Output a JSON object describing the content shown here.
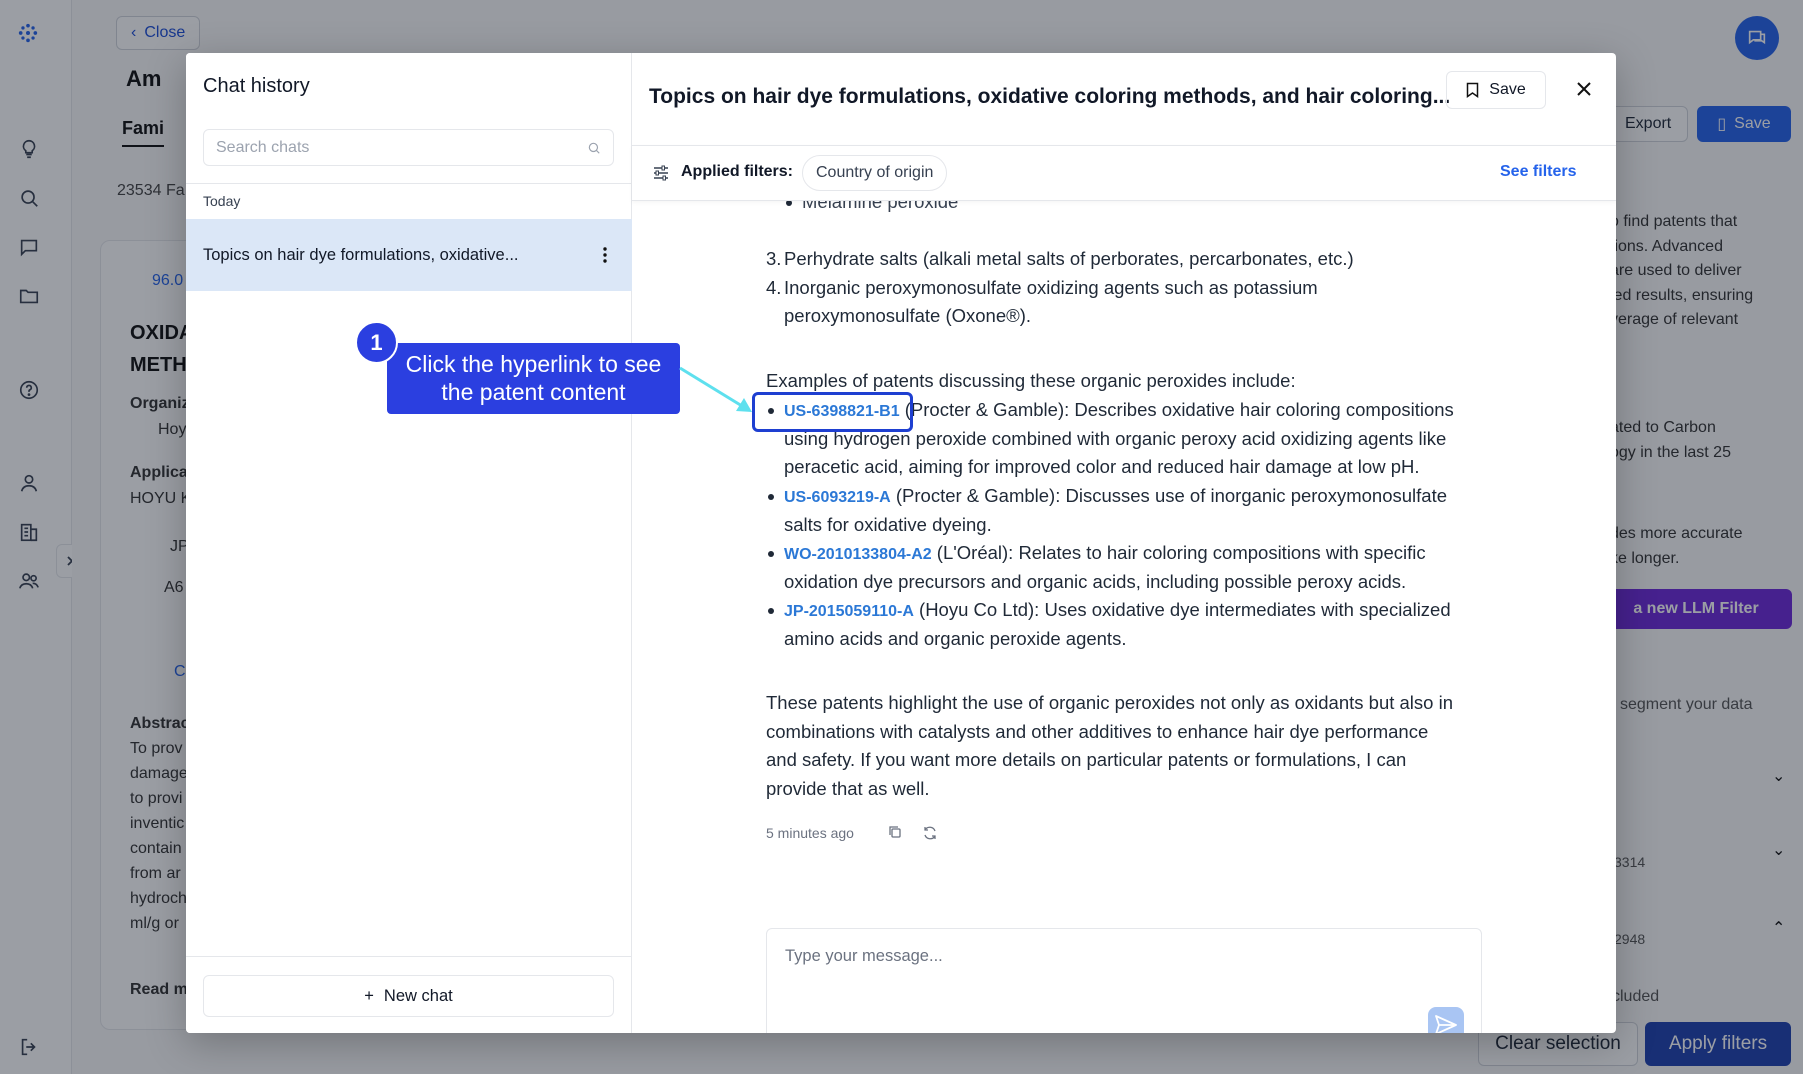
{
  "background": {
    "close_label": "Close",
    "title": "Am",
    "tab": "Fami",
    "count": "23534 Fa",
    "score": "96.0",
    "heading1": "OXIDA",
    "heading2": "METH",
    "org_label": "Organiz",
    "org_value": "Hoy",
    "applicant_label": "Applica",
    "applicant_value": "HOYU K",
    "jp": "JP",
    "a6": "A6",
    "doc_link": "C",
    "abstract_label": "Abstrac",
    "abstract_lines": [
      "To prov",
      "damage",
      "to provi",
      "inventic",
      "contain",
      "from ar",
      "hydroch",
      "ml/g or"
    ],
    "read_more": "Read m",
    "export_label": "Export",
    "save_label": "Save",
    "right_text_1": [
      "o find patents that",
      "tions. Advanced",
      "are used to deliver",
      "led results, ensuring",
      "verage of relevant"
    ],
    "right_text_2": [
      "ated to Carbon",
      "ogy in the last 25"
    ],
    "right_text_3": [
      "des more accurate",
      "ke longer."
    ],
    "llm_button": "a new LLM Filter",
    "segment_text": "segment your data",
    "num_3314": "3314",
    "num_2948": "2948",
    "cluded": "cluded",
    "clear_selection": "Clear selection",
    "apply_filters": "Apply filters"
  },
  "history": {
    "title": "Chat history",
    "search_placeholder": "Search chats",
    "group": "Today",
    "items": [
      {
        "label": "Topics on hair dye formulations, oxidative..."
      }
    ],
    "new_chat": "New chat"
  },
  "chat": {
    "title": "Topics on hair dye formulations, oxidative coloring methods, and hair coloring...",
    "save_label": "Save",
    "filters_label": "Applied filters:",
    "filter_chips": [
      "Country of origin"
    ],
    "see_filters": "See filters",
    "cut_item": "Melamine peroxide",
    "list_3_num": "3.",
    "list_3": "Perhydrate salts (alkali metal salts of perborates, percarbonates, etc.)",
    "list_4_num": "4.",
    "list_4a": "Inorganic peroxymonosulfate oxidizing agents such as potassium",
    "list_4b": "peroxymonosulfate (Oxone®).",
    "examples_intro": "Examples of patents discussing these organic peroxides include:",
    "patents": [
      {
        "id": "US-6398821-B1",
        "line1": " (Procter & Gamble): Describes oxidative hair coloring compositions",
        "line2": "using hydrogen peroxide combined with organic peroxy acid oxidizing agents like",
        "line3": "peracetic acid, aiming for improved color and reduced hair damage at low pH."
      },
      {
        "id": "US-6093219-A",
        "line1": " (Procter & Gamble): Discusses use of inorganic peroxymonosulfate",
        "line2": "salts for oxidative dyeing."
      },
      {
        "id": "WO-2010133804-A2",
        "line1": " (L'Oréal): Relates to hair coloring compositions with specific",
        "line2": "oxidation dye precursors and organic acids, including possible peroxy acids."
      },
      {
        "id": "JP-2015059110-A",
        "line1": " (Hoyu Co Ltd): Uses oxidative dye intermediates with specialized",
        "line2": "amino acids and organic peroxide agents."
      }
    ],
    "closing": [
      "These patents highlight the use of organic peroxides not only as oxidants but also in",
      "combinations with catalysts and other additives to enhance hair dye performance",
      "and safety. If you want more details on particular patents or formulations, I can",
      "provide that as well."
    ],
    "timestamp": "5 minutes ago",
    "composer_placeholder": "Type your message..."
  },
  "tutorial": {
    "step": "1",
    "line1": "Click the hyperlink to see",
    "line2": "the patent content",
    "accent": "#2b3fe0",
    "arrow_color": "#5ee0ee"
  }
}
